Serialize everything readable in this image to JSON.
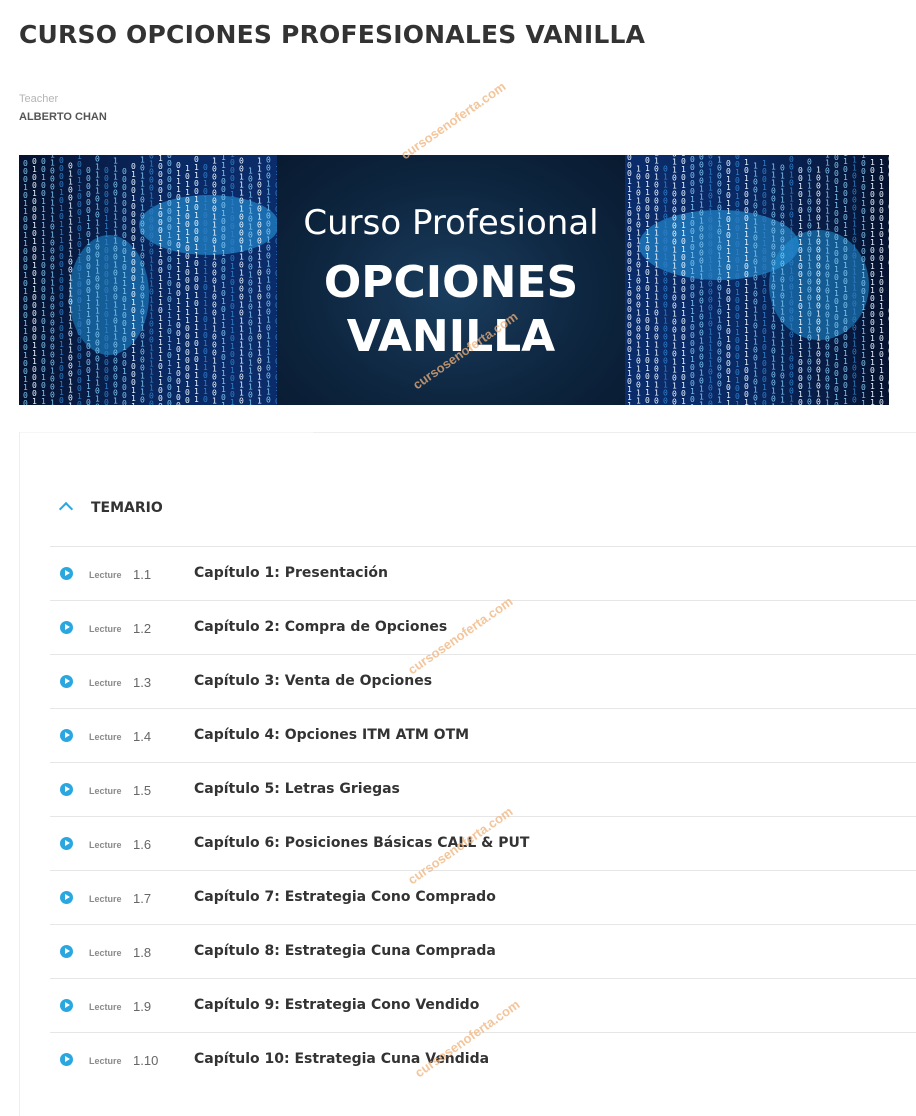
{
  "course": {
    "title": "CURSO OPCIONES PROFESIONALES VANILLA",
    "teacher_label": "Teacher",
    "teacher_name": "ALBERTO CHAN"
  },
  "banner": {
    "subtitle": "Curso Profesional",
    "title_line1": "OPCIONES",
    "title_line2": "VANILLA"
  },
  "curriculum": {
    "section_title": "TEMARIO",
    "lectures": [
      {
        "type": "Lecture",
        "number": "1.1",
        "title": "Capítulo 1: Presentación"
      },
      {
        "type": "Lecture",
        "number": "1.2",
        "title": "Capítulo 2: Compra de Opciones"
      },
      {
        "type": "Lecture",
        "number": "1.3",
        "title": "Capítulo 3: Venta de Opciones"
      },
      {
        "type": "Lecture",
        "number": "1.4",
        "title": "Capítulo 4: Opciones ITM ATM OTM"
      },
      {
        "type": "Lecture",
        "number": "1.5",
        "title": "Capítulo 5: Letras Griegas"
      },
      {
        "type": "Lecture",
        "number": "1.6",
        "title": "Capítulo 6: Posiciones Básicas CALL & PUT"
      },
      {
        "type": "Lecture",
        "number": "1.7",
        "title": "Capítulo 7: Estrategia Cono Comprado"
      },
      {
        "type": "Lecture",
        "number": "1.8",
        "title": "Capítulo 8: Estrategia Cuna Comprada"
      },
      {
        "type": "Lecture",
        "number": "1.9",
        "title": "Capítulo 9: Estrategia Cono Vendido"
      },
      {
        "type": "Lecture",
        "number": "1.10",
        "title": "Capítulo 10: Estrategia Cuna Vendida"
      }
    ]
  },
  "watermark": "cursosenoferta.com",
  "colors": {
    "accent": "#2aa7e0",
    "banner_dark": "#06122e",
    "banner_blue": "#0b2c6a",
    "watermark": "#f0b27a"
  },
  "icons": {
    "section_toggle": "chevron-up-icon",
    "lecture": "play-circle-icon"
  }
}
